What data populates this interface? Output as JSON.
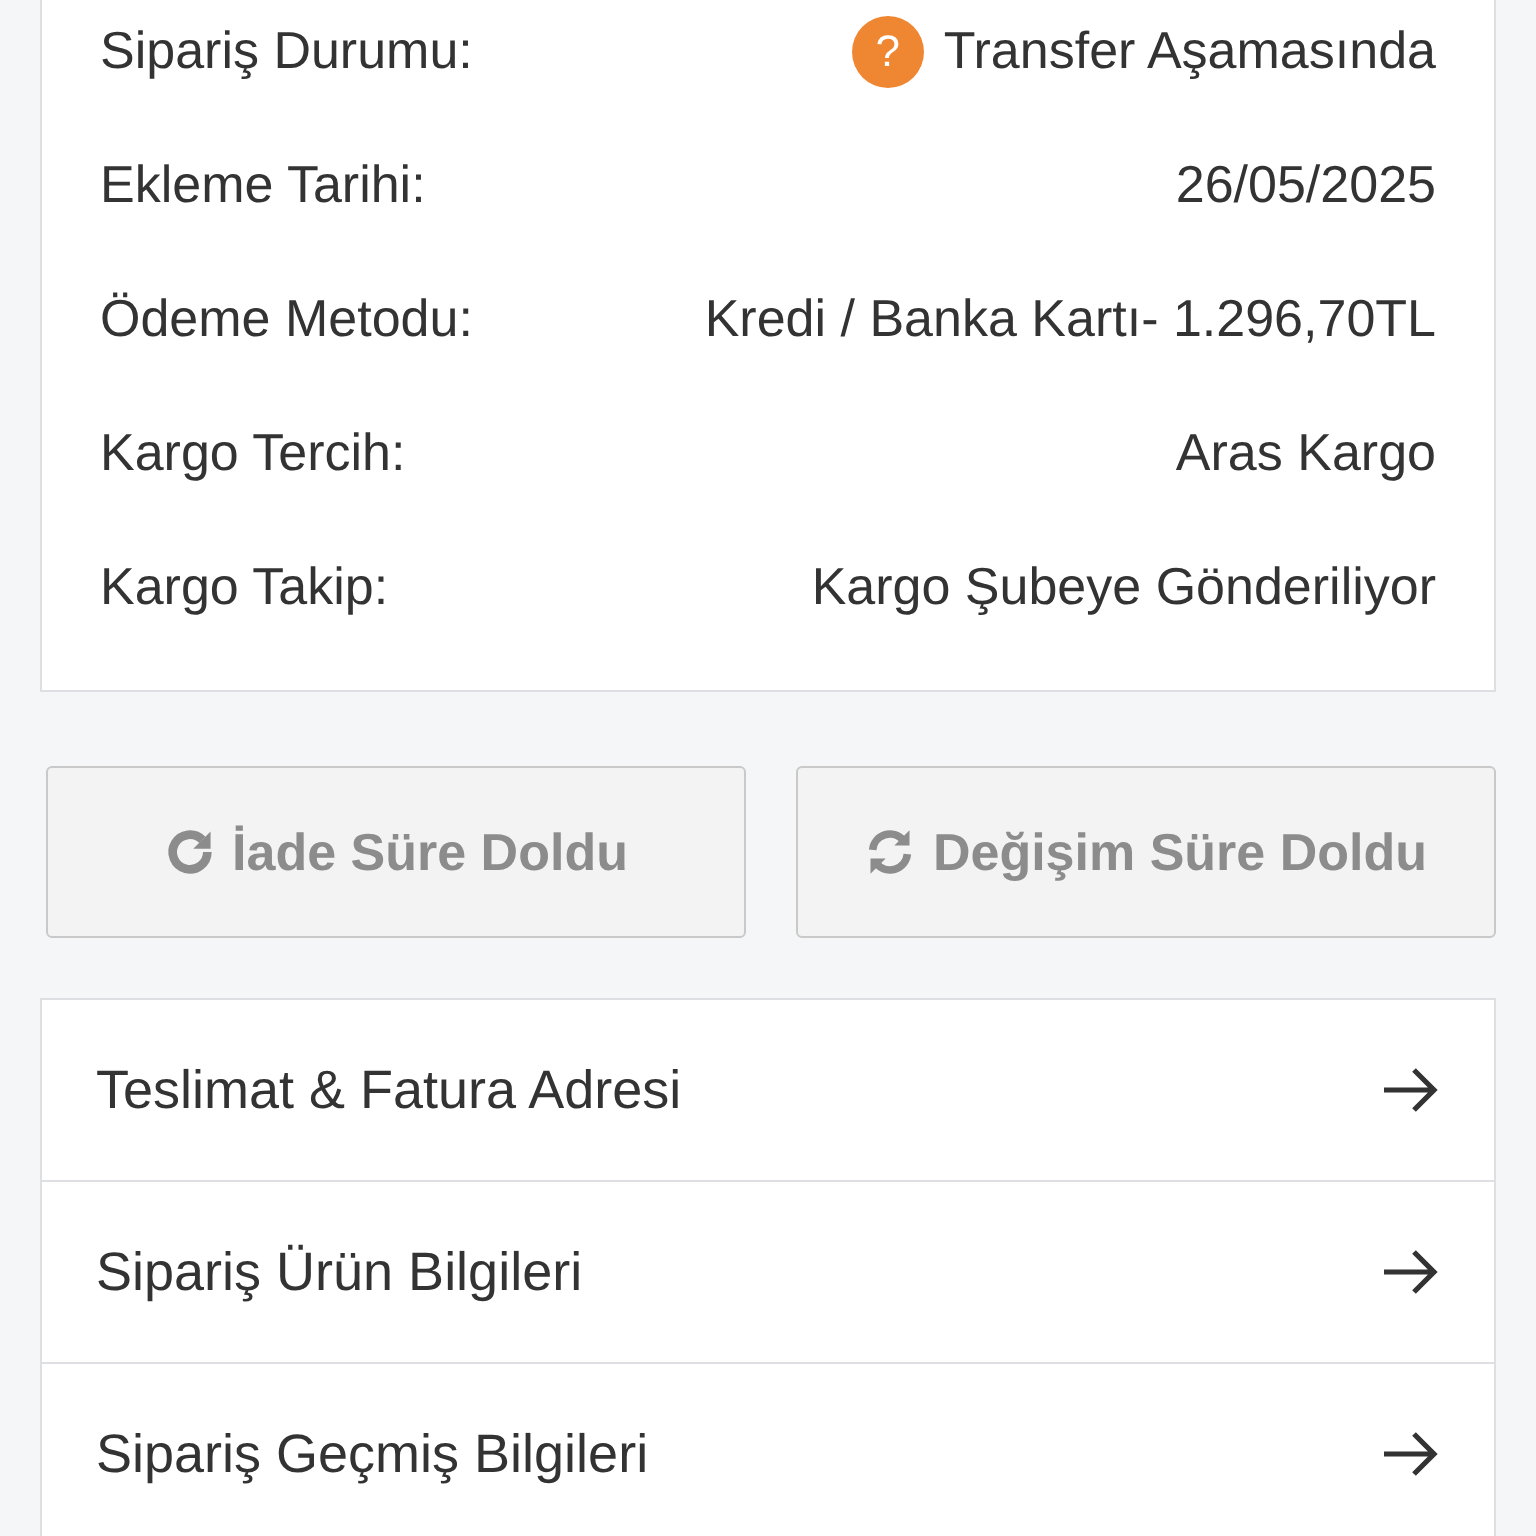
{
  "details": [
    {
      "label": "Sipariş Durumu:",
      "value": "Transfer Aşamasında",
      "kind": "status"
    },
    {
      "label": "Ekleme Tarihi:",
      "value": "26/05/2025",
      "kind": "text"
    },
    {
      "label": "Ödeme Metodu:",
      "value": "Kredi / Banka Kartı- 1.296,70TL",
      "kind": "text"
    },
    {
      "label": "Kargo Tercih:",
      "value": "Aras Kargo",
      "kind": "text"
    },
    {
      "label": "Kargo Takip:",
      "value": "Kargo Şubeye Gönderiliyor",
      "kind": "text"
    }
  ],
  "status_icon": "?",
  "actions": [
    {
      "label": "İade Süre Doldu",
      "kind": "return",
      "disabled": true
    },
    {
      "label": "Değişim Süre Doldu",
      "kind": "exchange",
      "disabled": true
    }
  ],
  "links": [
    {
      "label": "Teslimat & Fatura Adresi"
    },
    {
      "label": "Sipariş Ürün Bilgileri"
    },
    {
      "label": "Sipariş Geçmiş Bilgileri"
    }
  ]
}
